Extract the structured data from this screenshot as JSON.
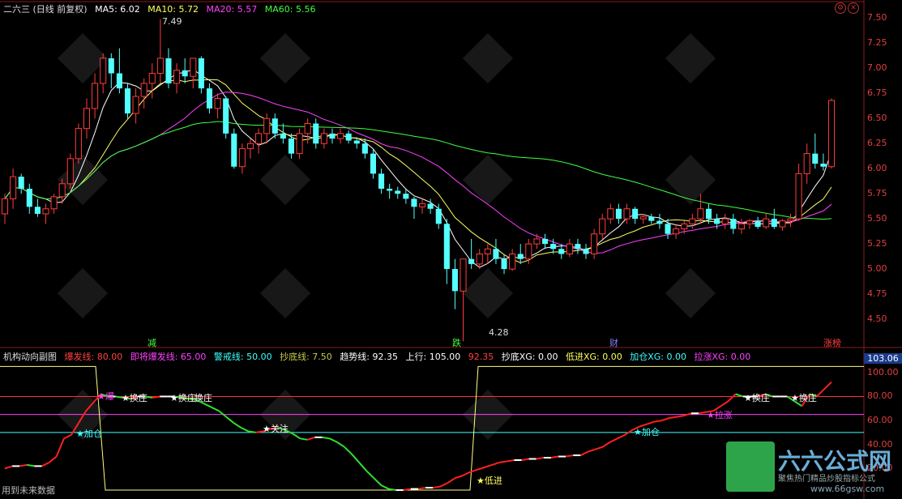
{
  "header": {
    "title": "二六三 (日线 前复权)",
    "ma": [
      {
        "label": "MA5: 6.02",
        "color": "#ffffff"
      },
      {
        "label": "MA10: 5.72",
        "color": "#ffff60"
      },
      {
        "label": "MA20: 5.57",
        "color": "#ff40ff"
      },
      {
        "label": "MA60: 5.56",
        "color": "#40ff40"
      }
    ]
  },
  "price_axis": {
    "ticks": [
      "7.50",
      "7.25",
      "7.00",
      "6.75",
      "6.50",
      "6.25",
      "6.00",
      "5.75",
      "5.50",
      "5.25",
      "5.00",
      "4.75",
      "4.50"
    ],
    "high_marker": "7.49",
    "low_marker": "4.28"
  },
  "event_labels": [
    {
      "text": "减",
      "color": "#40ff40"
    },
    {
      "text": "跌",
      "color": "#40ff40"
    },
    {
      "text": "财",
      "color": "#8080ff"
    },
    {
      "text": "涨榜",
      "color": "#ff4040"
    }
  ],
  "sub_panel": {
    "title": "机构动向副图",
    "params": [
      {
        "text": "爆发线: 80.00",
        "color": "#ff4040"
      },
      {
        "text": "即将爆发线: 65.00",
        "color": "#ff40ff"
      },
      {
        "text": "警戒线: 50.00",
        "color": "#40ffff"
      },
      {
        "text": "抄底线: 7.50",
        "color": "#c8c850"
      },
      {
        "text": "趋势线: 92.35",
        "color": "#ffffff"
      },
      {
        "text": "上行: 105.00",
        "color": "#ffffff"
      },
      {
        "text": "92.35",
        "color": "#ff4040"
      },
      {
        "text": "抄底XG: 0.00",
        "color": "#ffffff"
      },
      {
        "text": "低进XG: 0.00",
        "color": "#ffff60"
      },
      {
        "text": "加仓XG: 0.00",
        "color": "#40ffff"
      },
      {
        "text": "拉涨XG: 0.00",
        "color": "#ff40ff"
      }
    ],
    "current_value": "103.06",
    "ticks": [
      "100.00",
      "80.00",
      "60.00",
      "40.00",
      "20.00"
    ],
    "annotations": [
      {
        "text": "加仓",
        "color": "#40ffff"
      },
      {
        "text": "换庄",
        "color": "#ffffff"
      },
      {
        "text": "换庄",
        "color": "#ffffff"
      },
      {
        "text": "换庄",
        "color": "#ffffff"
      },
      {
        "text": "关注",
        "color": "#ffffff"
      },
      {
        "text": "低进",
        "color": "#ffff60"
      },
      {
        "text": "加仓",
        "color": "#40ffff"
      },
      {
        "text": "拉涨",
        "color": "#ff40ff"
      },
      {
        "text": "换庄",
        "color": "#ffffff"
      },
      {
        "text": "换庄",
        "color": "#ffffff"
      },
      {
        "text": "爆",
        "color": "#ff40ff"
      }
    ],
    "footer": "用到未来数据"
  },
  "watermark": {
    "brand": "六六公式网",
    "slogan": "聚焦热门精品炒股指标公式",
    "url": "www.66gsw.com"
  },
  "chart_data": {
    "type": "candlestick",
    "candles": [
      [
        5.55,
        5.75,
        5.45,
        5.7
      ],
      [
        5.7,
        6.0,
        5.6,
        5.92
      ],
      [
        5.92,
        5.95,
        5.75,
        5.8
      ],
      [
        5.8,
        5.85,
        5.55,
        5.62
      ],
      [
        5.62,
        5.7,
        5.52,
        5.55
      ],
      [
        5.55,
        5.65,
        5.45,
        5.6
      ],
      [
        5.6,
        5.75,
        5.55,
        5.72
      ],
      [
        5.72,
        5.9,
        5.65,
        5.85
      ],
      [
        5.85,
        6.15,
        5.8,
        6.1
      ],
      [
        6.1,
        6.45,
        6.05,
        6.4
      ],
      [
        6.4,
        6.7,
        6.3,
        6.6
      ],
      [
        6.6,
        6.95,
        6.5,
        6.85
      ],
      [
        6.85,
        7.15,
        6.75,
        7.1
      ],
      [
        7.1,
        7.15,
        6.8,
        6.95
      ],
      [
        6.95,
        7.2,
        6.75,
        6.8
      ],
      [
        6.8,
        6.85,
        6.5,
        6.55
      ],
      [
        6.55,
        6.8,
        6.45,
        6.72
      ],
      [
        6.72,
        6.9,
        6.6,
        6.85
      ],
      [
        6.85,
        7.05,
        6.7,
        6.95
      ],
      [
        6.95,
        7.49,
        6.85,
        7.1
      ],
      [
        7.1,
        7.2,
        6.8,
        6.85
      ],
      [
        6.85,
        7.05,
        6.75,
        6.98
      ],
      [
        6.98,
        7.1,
        6.85,
        6.92
      ],
      [
        6.92,
        7.05,
        6.8,
        7.1
      ],
      [
        7.1,
        7.12,
        6.75,
        6.8
      ],
      [
        6.8,
        6.85,
        6.55,
        6.6
      ],
      [
        6.6,
        6.75,
        6.5,
        6.7
      ],
      [
        6.7,
        6.72,
        6.3,
        6.35
      ],
      [
        6.35,
        6.4,
        6.0,
        6.02
      ],
      [
        6.02,
        6.25,
        5.95,
        6.2
      ],
      [
        6.2,
        6.3,
        6.1,
        6.25
      ],
      [
        6.25,
        6.4,
        6.15,
        6.35
      ],
      [
        6.35,
        6.55,
        6.25,
        6.5
      ],
      [
        6.5,
        6.55,
        6.3,
        6.35
      ],
      [
        6.35,
        6.45,
        6.25,
        6.3
      ],
      [
        6.3,
        6.35,
        6.1,
        6.15
      ],
      [
        6.15,
        6.4,
        6.1,
        6.35
      ],
      [
        6.35,
        6.5,
        6.25,
        6.45
      ],
      [
        6.45,
        6.5,
        6.2,
        6.25
      ],
      [
        6.25,
        6.4,
        6.2,
        6.35
      ],
      [
        6.35,
        6.4,
        6.25,
        6.3
      ],
      [
        6.3,
        6.4,
        6.25,
        6.35
      ],
      [
        6.35,
        6.38,
        6.25,
        6.28
      ],
      [
        6.28,
        6.3,
        6.2,
        6.25
      ],
      [
        6.25,
        6.3,
        6.1,
        6.15
      ],
      [
        6.15,
        6.2,
        5.9,
        5.95
      ],
      [
        5.95,
        6.0,
        5.75,
        5.8
      ],
      [
        5.8,
        5.85,
        5.7,
        5.78
      ],
      [
        5.78,
        5.82,
        5.7,
        5.75
      ],
      [
        5.75,
        5.8,
        5.65,
        5.7
      ],
      [
        5.7,
        5.72,
        5.5,
        5.62
      ],
      [
        5.62,
        5.7,
        5.55,
        5.65
      ],
      [
        5.65,
        5.7,
        5.55,
        5.6
      ],
      [
        5.6,
        5.65,
        5.4,
        5.45
      ],
      [
        5.45,
        5.5,
        4.85,
        5.0
      ],
      [
        5.0,
        5.1,
        4.6,
        4.78
      ],
      [
        4.78,
        5.1,
        4.28,
        5.1
      ],
      [
        5.1,
        5.3,
        5.0,
        5.05
      ],
      [
        5.05,
        5.2,
        5.0,
        5.15
      ],
      [
        5.15,
        5.25,
        5.05,
        5.2
      ],
      [
        5.2,
        5.3,
        5.05,
        5.1
      ],
      [
        5.1,
        5.15,
        4.95,
        5.0
      ],
      [
        5.0,
        5.2,
        4.98,
        5.15
      ],
      [
        5.15,
        5.25,
        5.05,
        5.1
      ],
      [
        5.1,
        5.3,
        5.05,
        5.25
      ],
      [
        5.25,
        5.35,
        5.2,
        5.3
      ],
      [
        5.3,
        5.35,
        5.2,
        5.25
      ],
      [
        5.25,
        5.3,
        5.15,
        5.2
      ],
      [
        5.2,
        5.25,
        5.1,
        5.15
      ],
      [
        5.15,
        5.3,
        5.12,
        5.25
      ],
      [
        5.25,
        5.3,
        5.15,
        5.2
      ],
      [
        5.2,
        5.25,
        5.1,
        5.15
      ],
      [
        5.15,
        5.4,
        5.1,
        5.35
      ],
      [
        5.35,
        5.55,
        5.3,
        5.5
      ],
      [
        5.5,
        5.65,
        5.45,
        5.6
      ],
      [
        5.6,
        5.65,
        5.45,
        5.5
      ],
      [
        5.5,
        5.65,
        5.45,
        5.6
      ],
      [
        5.6,
        5.62,
        5.45,
        5.5
      ],
      [
        5.5,
        5.55,
        5.45,
        5.52
      ],
      [
        5.52,
        5.55,
        5.45,
        5.48
      ],
      [
        5.48,
        5.55,
        5.4,
        5.45
      ],
      [
        5.45,
        5.5,
        5.3,
        5.35
      ],
      [
        5.35,
        5.45,
        5.3,
        5.4
      ],
      [
        5.4,
        5.48,
        5.35,
        5.45
      ],
      [
        5.45,
        5.55,
        5.4,
        5.5
      ],
      [
        5.5,
        5.75,
        5.45,
        5.6
      ],
      [
        5.6,
        5.65,
        5.45,
        5.5
      ],
      [
        5.5,
        5.55,
        5.4,
        5.45
      ],
      [
        5.45,
        5.55,
        5.4,
        5.5
      ],
      [
        5.5,
        5.55,
        5.35,
        5.4
      ],
      [
        5.4,
        5.5,
        5.35,
        5.45
      ],
      [
        5.45,
        5.5,
        5.4,
        5.48
      ],
      [
        5.48,
        5.52,
        5.4,
        5.42
      ],
      [
        5.42,
        5.55,
        5.4,
        5.5
      ],
      [
        5.5,
        5.6,
        5.4,
        5.42
      ],
      [
        5.42,
        5.5,
        5.38,
        5.48
      ],
      [
        5.48,
        5.55,
        5.42,
        5.5
      ],
      [
        5.5,
        6.05,
        5.48,
        5.95
      ],
      [
        5.95,
        6.25,
        5.85,
        6.15
      ],
      [
        6.15,
        6.35,
        6.0,
        6.05
      ],
      [
        6.05,
        6.15,
        5.98,
        6.02
      ],
      [
        6.02,
        6.7,
        6.0,
        6.68
      ]
    ],
    "ma": {
      "MA5": 6.02,
      "MA10": 5.72,
      "MA20": 5.57,
      "MA60": 5.56
    },
    "y_range": [
      4.25,
      7.6
    ],
    "sub_series": [
      20,
      22,
      22,
      23,
      22,
      22,
      25,
      30,
      45,
      48,
      58,
      68,
      75,
      82,
      80,
      80,
      79,
      78,
      80,
      80,
      79,
      80,
      80,
      80,
      79,
      78,
      77,
      74,
      71,
      68,
      63,
      58,
      54,
      51,
      50,
      51,
      53,
      54,
      52,
      49,
      45,
      44,
      46,
      46,
      45,
      42,
      38,
      32,
      25,
      18,
      12,
      6,
      3,
      2,
      2,
      3,
      3,
      4,
      4,
      5,
      8,
      12,
      14,
      17,
      19,
      21,
      23,
      25,
      26,
      27,
      27,
      28,
      28,
      29,
      29,
      30,
      30,
      31,
      31,
      34,
      36,
      38,
      42,
      45,
      48,
      52,
      55,
      57,
      59,
      60,
      62,
      63,
      64,
      66,
      66,
      67,
      68,
      72,
      76,
      82,
      80,
      80,
      80,
      82,
      80,
      80,
      80,
      76,
      72,
      82,
      80,
      86,
      92
    ],
    "sub_levels": {
      "爆发线": 80,
      "即将爆发线": 65,
      "警戒线": 50,
      "抄底线": 7.5,
      "上行": 105
    },
    "sub_range": [
      0,
      110
    ]
  }
}
